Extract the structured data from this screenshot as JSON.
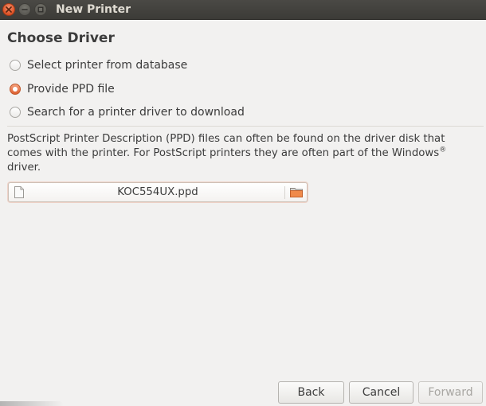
{
  "window": {
    "title": "New Printer"
  },
  "page": {
    "heading": "Choose Driver"
  },
  "options": [
    {
      "label": "Select printer from database",
      "checked": false
    },
    {
      "label": "Provide PPD file",
      "checked": true
    },
    {
      "label": "Search for a printer driver to download",
      "checked": false
    }
  ],
  "description": {
    "line1": "PostScript Printer Description (PPD) files can often be found on the driver disk that",
    "line2": "comes with the printer. For PostScript printers they are often part of the Windows",
    "registered": "®",
    "line3": "driver."
  },
  "file_chooser": {
    "value": "KOC554UX.ppd"
  },
  "buttons": {
    "back": "Back",
    "cancel": "Cancel",
    "forward": "Forward"
  },
  "colors": {
    "accent": "#dd5f2f",
    "titlebar": "#3c3b37",
    "background": "#f2f1f0"
  },
  "icons": {
    "close": "close-icon",
    "minimize": "minimize-icon",
    "maximize": "maximize-icon",
    "document": "document-icon",
    "folder": "folder-icon"
  }
}
